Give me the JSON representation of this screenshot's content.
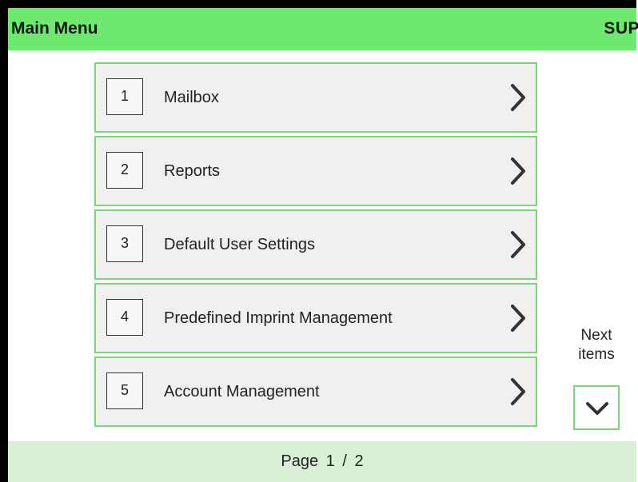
{
  "header": {
    "title": "Main Menu",
    "user": "SUP"
  },
  "menu": {
    "items": [
      {
        "number": "1",
        "label": "Mailbox",
        "icon": "chevron-right-icon"
      },
      {
        "number": "2",
        "label": "Reports",
        "icon": "chevron-right-icon"
      },
      {
        "number": "3",
        "label": "Default User Settings",
        "icon": "chevron-right-icon"
      },
      {
        "number": "4",
        "label": "Predefined Imprint Management",
        "icon": "chevron-right-icon"
      },
      {
        "number": "5",
        "label": "Account Management",
        "icon": "chevron-right-icon"
      }
    ]
  },
  "next_items": {
    "line1": "Next",
    "line2": "items",
    "icon": "chevron-down-icon"
  },
  "footer": {
    "page_label": "Page",
    "page_value": "1 / 2"
  },
  "colors": {
    "header_bg": "#6ee86e",
    "item_border": "#7bd67b",
    "item_bg": "#f0f0f0",
    "footer_bg": "#daf0d6"
  }
}
